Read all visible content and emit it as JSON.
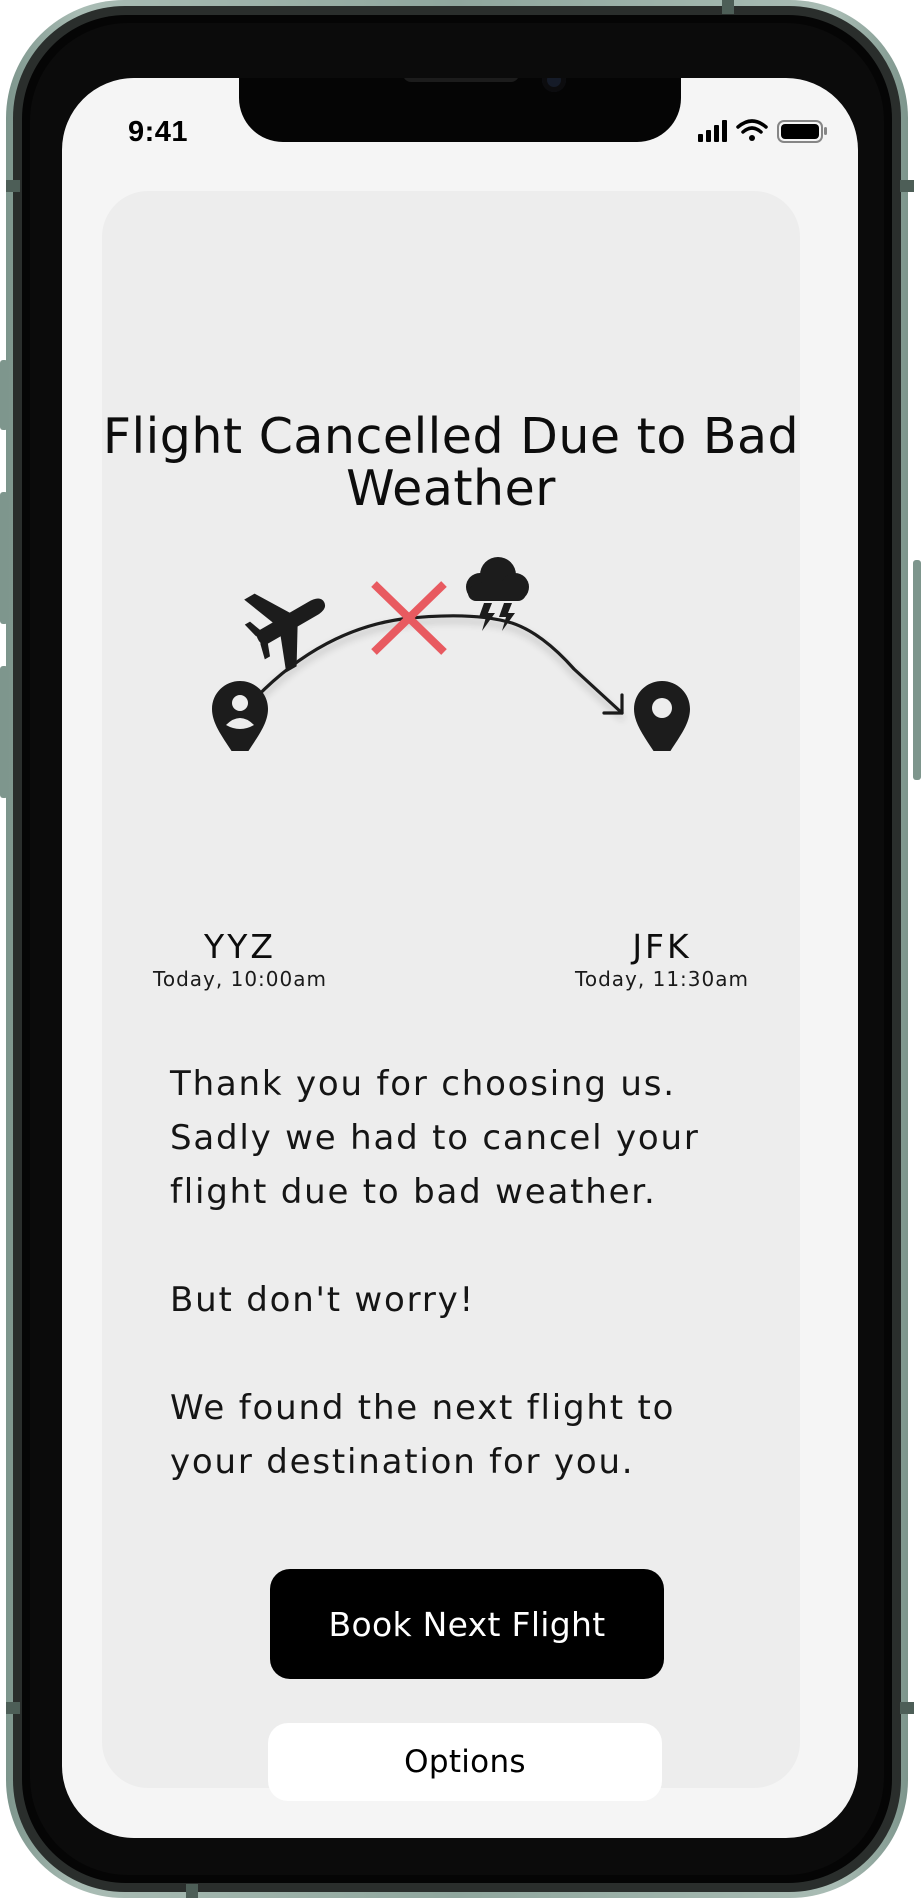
{
  "status_bar": {
    "time": "9:41"
  },
  "alert": {
    "title": "Flight Cancelled Due to Bad Weather",
    "origin": {
      "code": "YYZ",
      "time": "Today, 10:00am"
    },
    "destination": {
      "code": "JFK",
      "time": "Today, 11:30am"
    },
    "status_icons": [
      "airplane-icon",
      "cancel-x-icon",
      "thunderstorm-icon",
      "origin-pin-icon",
      "destination-pin-icon"
    ],
    "paragraphs": [
      "Thank you for choosing us. Sadly we had to cancel your flight due to bad weather.",
      "But don't worry!",
      "We found the next flight to your destination for you."
    ]
  },
  "actions": {
    "primary_label": "Book Next Flight",
    "secondary_label": "Options"
  },
  "colors": {
    "cancel_mark": "#e85a60",
    "card_background": "#ededed",
    "primary_button": "#000000",
    "phone_frame": "#8fa69d"
  }
}
